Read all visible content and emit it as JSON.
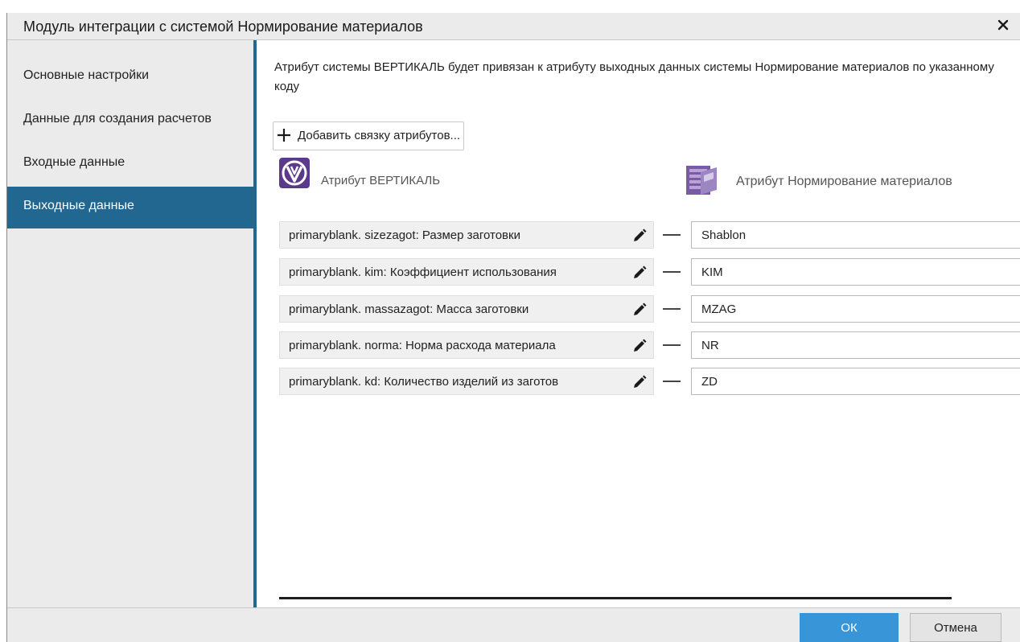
{
  "window": {
    "title": "Модуль интеграции с системой Нормирование материалов",
    "close_icon": "close-icon"
  },
  "sidebar": {
    "items": [
      {
        "label": "Основные настройки",
        "active": false
      },
      {
        "label": "Данные для создания расчетов",
        "active": false
      },
      {
        "label": "Входные данные",
        "active": false
      },
      {
        "label": "Выходные данные",
        "active": true
      }
    ]
  },
  "main": {
    "description": "Атрибут системы ВЕРТИКАЛЬ будет привязан к атрибуту выходных данных системы Нормирование материалов по указанному коду",
    "add_button_label": "Добавить связку атрибутов...",
    "header_left": "Атрибут ВЕРТИКАЛЬ",
    "header_right": "Атрибут Нормирование материалов",
    "rows": [
      {
        "attribute": "primaryblank. sizezagot: Размер заготовки",
        "code": "Shablon"
      },
      {
        "attribute": "primaryblank. kim: Коэффициент использования",
        "code": "KIM"
      },
      {
        "attribute": "primaryblank. massazagot: Масса заготовки",
        "code": "MZAG"
      },
      {
        "attribute": "primaryblank. norma: Норма расхода материала",
        "code": "NR"
      },
      {
        "attribute": "primaryblank. kd: Количество изделий из заготов",
        "code": "ZD"
      }
    ]
  },
  "footer": {
    "ok_label": "ОК",
    "cancel_label": "Отмена"
  },
  "colors": {
    "accent": "#22678f",
    "ok_button": "#3795d8",
    "panel_bg": "#ebebeb",
    "vertical_logo": "#5b3a8c",
    "norm_logo": "#7a5aa6"
  }
}
